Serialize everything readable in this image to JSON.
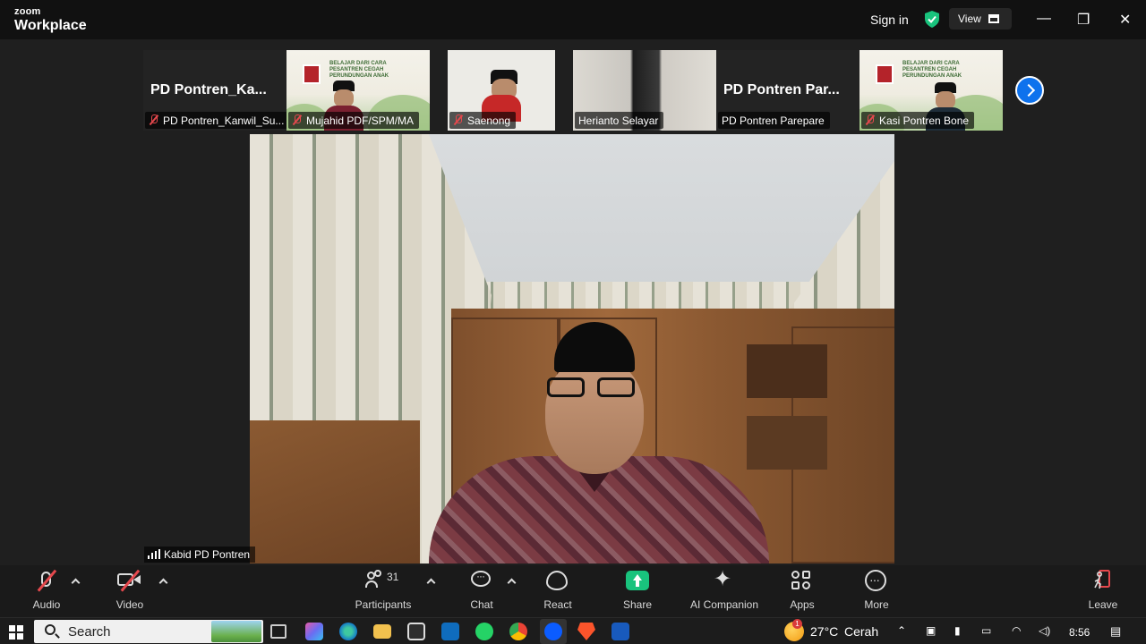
{
  "titlebar": {
    "brand_small": "zoom",
    "brand_big": "Workplace",
    "signin": "Sign in",
    "view_label": "View",
    "minimize": "—",
    "restore": "❐",
    "close": "✕"
  },
  "thumbnails": [
    {
      "big_name": "PD  Pontren_Ka...",
      "caption": "PD Pontren_Kanwil_Su..."
    },
    {
      "caption": "Mujahid PDF/SPM/MA"
    },
    {
      "caption": "Saenong"
    },
    {
      "caption": "Herianto Selayar"
    },
    {
      "big_name": "PD  Pontren  Par...",
      "caption": "PD Pontren Parepare"
    },
    {
      "caption": "Kasi Pontren Bone"
    }
  ],
  "banner_text": "BELAJAR DARI CARA PESANTREN CEGAH PERUNDUNGAN ANAK",
  "main_video": {
    "caption": "Kabid PD Pontren"
  },
  "toolbar": {
    "audio": "Audio",
    "video": "Video",
    "participants": "Participants",
    "participants_count": "31",
    "chat": "Chat",
    "react": "React",
    "share": "Share",
    "ai_companion": "AI Companion",
    "apps": "Apps",
    "more": "More",
    "leave": "Leave"
  },
  "taskbar": {
    "search": "Search",
    "weather_temp": "27°C",
    "weather_desc": "Cerah",
    "weather_badge": "1",
    "time": "8:56"
  },
  "colors": {
    "accent": "#0e72ed",
    "share_green": "#19c37d",
    "muted_red": "#e5484d"
  }
}
